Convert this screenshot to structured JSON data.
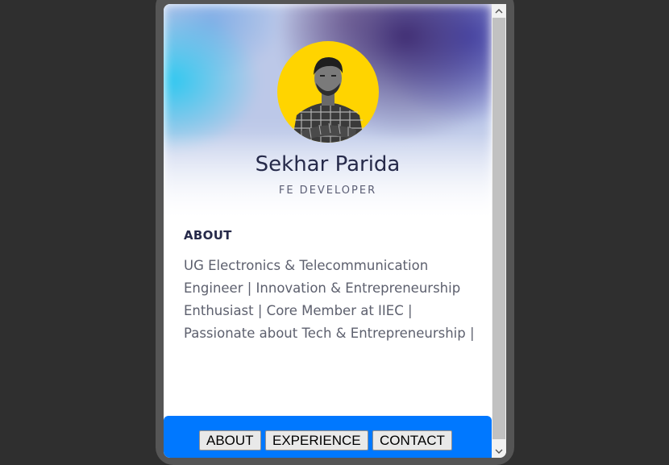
{
  "profile": {
    "name": "Sekhar Parida",
    "role": "FE DEVELOPER"
  },
  "about": {
    "heading": "ABOUT",
    "text": "UG Electronics & Telecommunication Engineer | Innovation & Entrepreneurship Enthusiast | Core Member at IIEC | Passionate about Tech & Entrepreneurship |"
  },
  "nav": {
    "about_label": "ABOUT",
    "experience_label": "EXPERIENCE",
    "contact_label": "CONTACT"
  },
  "scrollbar": {
    "up_icon": "chevron-up-icon",
    "down_icon": "chevron-down-icon"
  },
  "colors": {
    "accent": "#0078ff",
    "avatar_bg": "#ffd400",
    "name": "#262a4a",
    "body_text": "#5d606e"
  }
}
